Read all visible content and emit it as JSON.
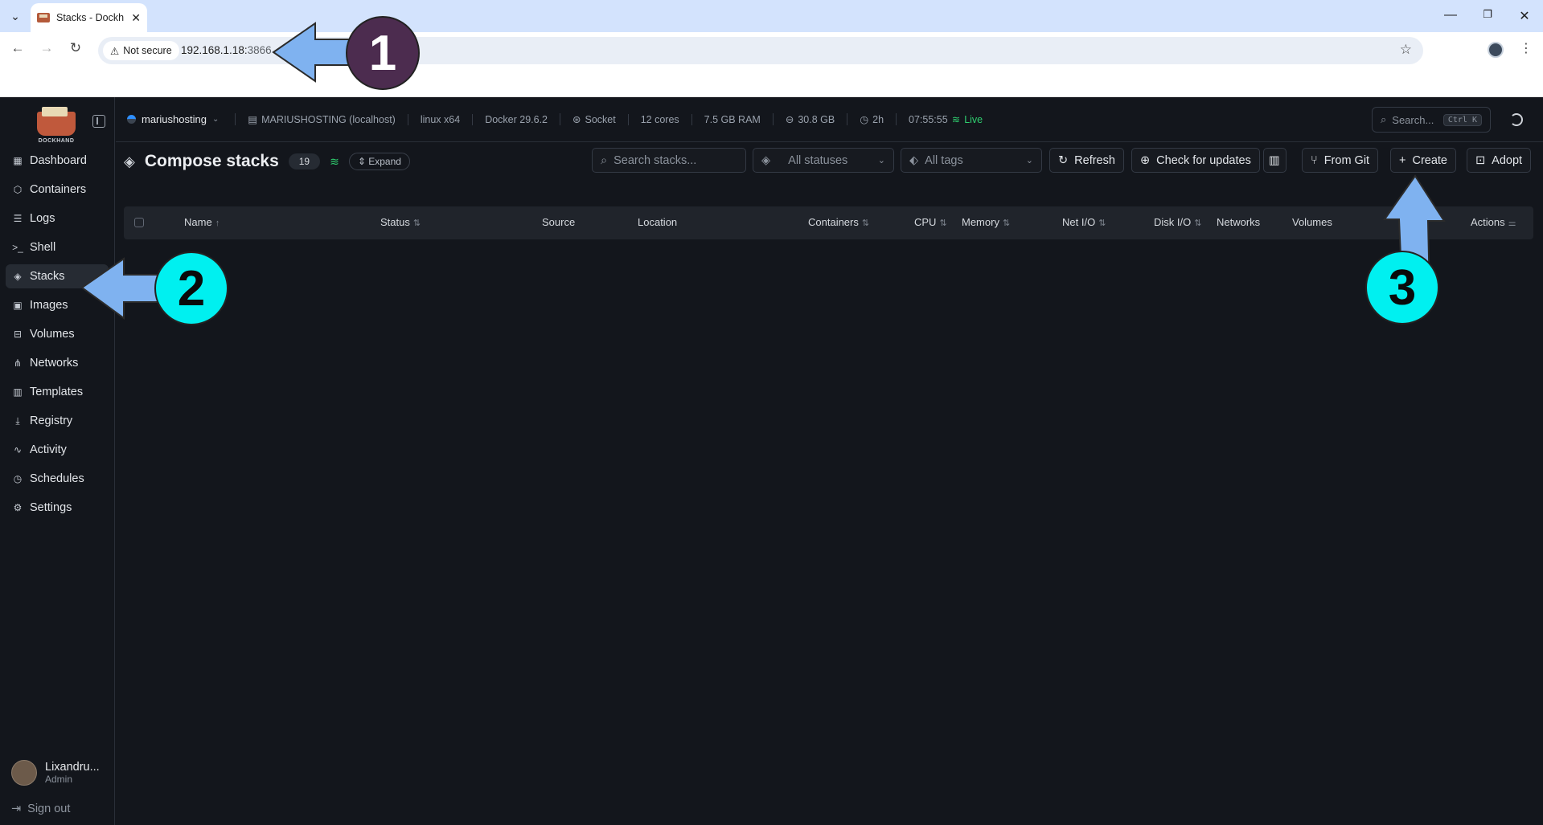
{
  "browser": {
    "tab_title": "Stacks - Dockh",
    "not_secure": "Not secure",
    "url_host": "192.168.1.18:",
    "url_port": "3866"
  },
  "sidebar": {
    "logo_label": "DOCKHAND",
    "items": [
      {
        "label": "Dashboard",
        "icon": "dashboard-icon",
        "glyph": "▦"
      },
      {
        "label": "Containers",
        "icon": "box-icon",
        "glyph": "⬡"
      },
      {
        "label": "Logs",
        "icon": "logs-icon",
        "glyph": "☰"
      },
      {
        "label": "Shell",
        "icon": "terminal-icon",
        "glyph": ">_"
      },
      {
        "label": "Stacks",
        "icon": "layers-icon",
        "glyph": "◈"
      },
      {
        "label": "Images",
        "icon": "images-icon",
        "glyph": "▣"
      },
      {
        "label": "Volumes",
        "icon": "drive-icon",
        "glyph": "⊟"
      },
      {
        "label": "Networks",
        "icon": "network-icon",
        "glyph": "⋔"
      },
      {
        "label": "Templates",
        "icon": "library-icon",
        "glyph": "▥"
      },
      {
        "label": "Registry",
        "icon": "download-icon",
        "glyph": "⤓"
      },
      {
        "label": "Activity",
        "icon": "activity-icon",
        "glyph": "∿"
      },
      {
        "label": "Schedules",
        "icon": "timer-icon",
        "glyph": "◷"
      },
      {
        "label": "Settings",
        "icon": "gear-icon",
        "glyph": "⚙"
      }
    ],
    "user_name": "Lixandru...",
    "user_role": "Admin",
    "sign_out": "Sign out"
  },
  "topbar": {
    "env_name": "mariushosting",
    "host": "MARIUSHOSTING (localhost)",
    "os": "linux x64",
    "docker": "Docker 29.6.2",
    "socket": "Socket",
    "cores": "12 cores",
    "ram": "7.5 GB RAM",
    "disk": "30.8 GB",
    "uptime": "2h",
    "clock": "07:55:55",
    "live": "Live",
    "search_placeholder": "Search...",
    "search_kbd": "Ctrl K"
  },
  "page": {
    "title": "Compose stacks",
    "count": "19",
    "expand": "Expand",
    "search_placeholder": "Search stacks...",
    "status_filter": "All statuses",
    "tag_filter": "All tags",
    "refresh": "Refresh",
    "check_updates": "Check for updates",
    "from_git": "From Git",
    "create": "Create",
    "adopt": "Adopt"
  },
  "table": {
    "columns": [
      "Name",
      "Status",
      "Source",
      "Location",
      "Containers",
      "CPU",
      "Memory",
      "Net I/O",
      "Disk I/O",
      "Networks",
      "Volumes",
      "Actions"
    ]
  },
  "annotations": {
    "one": "1",
    "two": "2",
    "three": "3"
  },
  "colors": {
    "live": "#2fcf6f",
    "arrow": "#7fb2f0",
    "badge_cyan": "#00f0f0",
    "badge_dark": "#4c2c4f"
  }
}
